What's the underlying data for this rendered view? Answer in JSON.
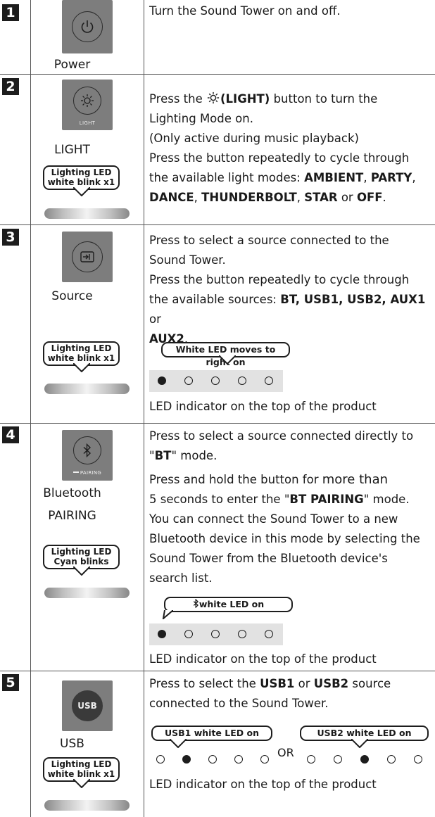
{
  "rows": [
    {
      "number": "1",
      "label": "Power",
      "icon": "power-icon",
      "description": "Turn the Sound Tower on and off."
    },
    {
      "number": "2",
      "label": "LIGHT",
      "icon": "light-icon",
      "button_sublabel": "LIGHT",
      "bubble": [
        "Lighting LED",
        "white blink x1"
      ],
      "description_parts": {
        "press_the": "Press the ",
        "light_button": "(LIGHT)",
        "button_to_turn": " button to turn the",
        "line2": "Lighting Mode on.",
        "line3": "(Only active during music playback)",
        "line4": "Press the button repeatedly to cycle through",
        "line5_prefix": "the available light modes: ",
        "modes": [
          "AMBIENT",
          "PARTY",
          "DANCE",
          "THUNDERBOLT",
          "STAR",
          "OFF"
        ],
        "or": " or "
      }
    },
    {
      "number": "3",
      "label": "Source",
      "icon": "source-icon",
      "bubble": [
        "Lighting LED",
        "white blink x1"
      ],
      "lines": [
        "Press to select a source connected to the",
        "Sound Tower.",
        "Press the button repeatedly to cycle through"
      ],
      "sources_prefix": "the available sources: ",
      "sources": [
        "BT, USB1, USB2, AUX1",
        "AUX2"
      ],
      "sources_or": " or ",
      "led_bubble": "White LED moves to right on",
      "leds": [
        true,
        false,
        false,
        false,
        false
      ],
      "caption": "LED indicator on the top of the product"
    },
    {
      "number": "4",
      "label_lines": [
        "Bluetooth",
        "PAIRING"
      ],
      "icon": "bluetooth-icon",
      "button_sublabel": "PAIRING",
      "bubble": [
        "Lighting LED",
        "Cyan blinks"
      ],
      "line1": "Press to select a source connected directly to",
      "bt_quote_open": "\"",
      "bt": "BT",
      "bt_quote_close": "\" mode.",
      "line3_a": "Press and hold the button for ",
      "line3_b": "more than",
      "line4_a": "5 seconds to enter the \"",
      "line4_bold": "BT PAIRING",
      "line4_b": "\" mode.",
      "more_lines": [
        "You can connect the Sound Tower to a new",
        "Bluetooth device in this mode by selecting the",
        "Sound Tower from the Bluetooth device's",
        "search list."
      ],
      "led_bubble": "white LED on",
      "leds": [
        true,
        false,
        false,
        false,
        false
      ],
      "caption": "LED indicator on the top of the product"
    },
    {
      "number": "5",
      "label": "USB",
      "icon": "usb-icon",
      "button_text": "USB",
      "bubble": [
        "Lighting LED",
        "white blink x1"
      ],
      "line1_a": "Press to select the ",
      "usb1": "USB1",
      "line1_or": " or ",
      "usb2": "USB2",
      "line1_b": " source",
      "line2": "connected to the Sound Tower.",
      "led_bubble_1": "USB1 white LED on",
      "led_bubble_2": "USB2 white LED on",
      "or_text": "OR",
      "leds_1": [
        false,
        true,
        false,
        false,
        false
      ],
      "leds_2": [
        false,
        false,
        true,
        false,
        false
      ],
      "caption": "LED indicator on the top of the product"
    }
  ]
}
